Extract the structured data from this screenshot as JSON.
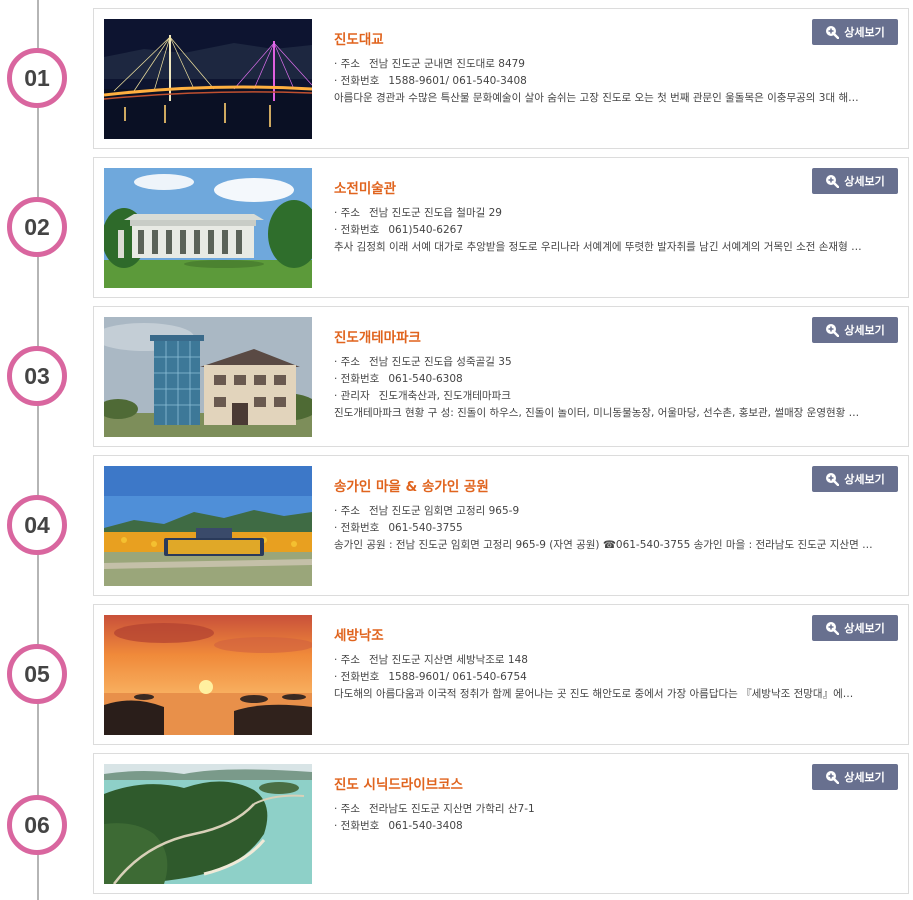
{
  "detail_label": "상세보기",
  "items": [
    {
      "number": "01",
      "title": "진도대교",
      "rows": [
        {
          "key": "· 주소",
          "value": "전남 진도군 군내면 진도대로 8479"
        },
        {
          "key": "· 전화번호",
          "value": "1588-9601/ 061-540-3408"
        }
      ],
      "description": "아름다운 경관과 수많은 특산물 문화예술이 살아 숨쉬는 고장 진도로 오는 첫 번째 관문인 울돌목은 이충무공의 3대 해…"
    },
    {
      "number": "02",
      "title": "소전미술관",
      "rows": [
        {
          "key": "· 주소",
          "value": "전남 진도군 진도읍 철마길 29"
        },
        {
          "key": "· 전화번호",
          "value": "061)540-6267"
        }
      ],
      "description": "추사 김정희 이래 서예 대가로 추앙받을 정도로 우리나라 서예계에 뚜렷한 발자취를 남긴 서예계의 거목인 소전 손재형 …"
    },
    {
      "number": "03",
      "title": "진도개테마파크",
      "rows": [
        {
          "key": "· 주소",
          "value": "전남 진도군 진도읍 성죽골길 35"
        },
        {
          "key": "· 전화번호",
          "value": "061-540-6308"
        },
        {
          "key": "· 관리자",
          "value": "진도개축산과, 진도개테마파크"
        }
      ],
      "description": "진도개테마파크 현황 구 성: 진돌이 하우스, 진돌이 놀이터, 미니동물농장, 어울마당, 선수촌, 홍보관, 썰매장 운영현황 …"
    },
    {
      "number": "04",
      "title": "송가인 마을 & 송가인 공원",
      "rows": [
        {
          "key": "· 주소",
          "value": "전남 진도군 임회면 고정리 965-9"
        },
        {
          "key": "· 전화번호",
          "value": "061-540-3755"
        }
      ],
      "description": "송가인 공원 : 전남 진도군 임회면 고정리 965-9 (자연 공원) ☎061-540-3755 송가인 마을 : 전라남도 진도군 지산면 앵…"
    },
    {
      "number": "05",
      "title": "세방낙조",
      "rows": [
        {
          "key": "· 주소",
          "value": "전남 진도군 지산면 세방낙조로 148"
        },
        {
          "key": "· 전화번호",
          "value": "1588-9601/ 061-540-6754"
        }
      ],
      "description": "다도해의 아름다움과 이국적 정취가 함께 묻어나는 곳 진도 해안도로 중에서 가장 아름답다는 『세방낙조 전망대』에…"
    },
    {
      "number": "06",
      "title": "진도 시닉드라이브코스",
      "rows": [
        {
          "key": "· 주소",
          "value": "전라남도 진도군 지산면 가학리 산7-1"
        },
        {
          "key": "· 전화번호",
          "value": "061-540-3408"
        }
      ],
      "description": ""
    }
  ]
}
